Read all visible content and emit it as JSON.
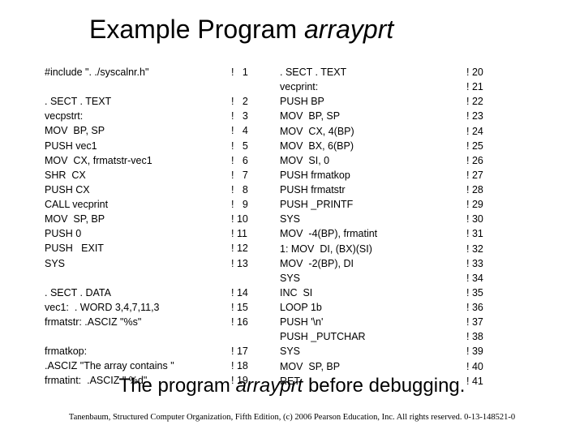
{
  "title_prefix": "Example Program ",
  "title_italic": "arrayprt",
  "left_code": [
    "#include \". ./syscalnr.h\"",
    "",
    ". SECT . TEXT",
    "vecpstrt:",
    "MOV  BP, SP",
    "PUSH vec1",
    "MOV  CX, frmatstr-vec1",
    "SHR  CX",
    "PUSH CX",
    "CALL vecprint",
    "MOV  SP, BP",
    "PUSH 0",
    "PUSH   EXIT",
    "SYS",
    "",
    ". SECT . DATA",
    "vec1:  . WORD 3,4,7,11,3",
    "frmatstr: .ASCIZ \"%s\"",
    "",
    "frmatkop:",
    ".ASCIZ \"The array contains \"",
    "frmatint:  .ASCIZ \" %d\""
  ],
  "left_ln": [
    "!   1",
    "",
    "!   2",
    "!   3",
    "!   4",
    "!   5",
    "!   6",
    "!   7",
    "!   8",
    "!   9",
    "! 10",
    "! 11",
    "! 12",
    "! 13",
    "",
    "! 14",
    "! 15",
    "! 16",
    "",
    "! 17",
    "! 18",
    "! 19"
  ],
  "right_code": [
    ". SECT . TEXT",
    "vecprint:",
    "PUSH BP",
    "MOV  BP, SP",
    "MOV  CX, 4(BP)",
    "MOV  BX, 6(BP)",
    "MOV  SI, 0",
    "PUSH frmatkop",
    "PUSH frmatstr",
    "PUSH _PRINTF",
    "SYS",
    "MOV  -4(BP), frmatint",
    "1: MOV  DI, (BX)(SI)",
    "MOV  -2(BP), DI",
    "SYS",
    "INC  SI",
    "LOOP 1b",
    "PUSH '\\n'",
    "PUSH _PUTCHAR",
    "SYS",
    "MOV  SP, BP",
    "RET"
  ],
  "right_ln": [
    "! 20",
    "! 21",
    "! 22",
    "! 23",
    "! 24",
    "! 25",
    "! 26",
    "! 27",
    "! 28",
    "! 29",
    "! 30",
    "! 31",
    "! 32",
    "! 33",
    "! 34",
    "! 35",
    "! 36",
    "! 37",
    "! 38",
    "! 39",
    "! 40",
    "! 41"
  ],
  "caption_prefix": "The program ",
  "caption_italic": "arrayprt",
  "caption_suffix": " before debugging.",
  "footer": "Tanenbaum, Structured Computer Organization, Fifth Edition, (c) 2006 Pearson Education, Inc. All rights reserved. 0-13-148521-0"
}
